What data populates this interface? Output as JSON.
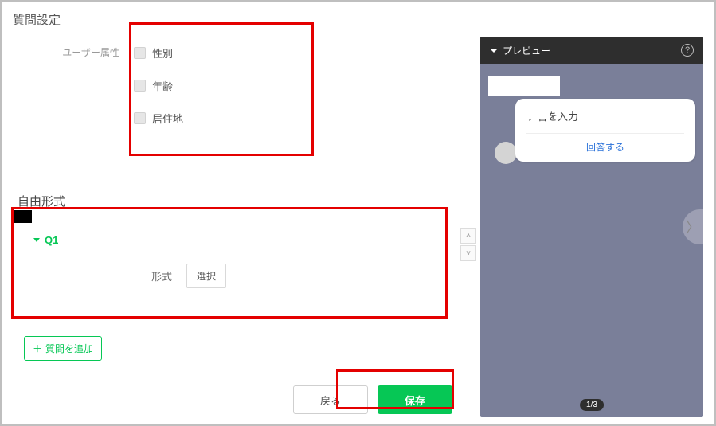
{
  "section_title": "質問設定",
  "user_attr": {
    "label": "ユーザー属性",
    "options": [
      "性別",
      "年齢",
      "居住地"
    ]
  },
  "free_form_title": "自由形式",
  "q1": {
    "id": "Q1",
    "format_label": "形式",
    "select_label": "選択"
  },
  "add_question_label": "質問を追加",
  "buttons": {
    "back": "戻る",
    "save": "保存"
  },
  "preview": {
    "header": "プレビュー",
    "bubble_text": "チ名を入力",
    "answer_link": "回答する",
    "pager": "1/3"
  }
}
